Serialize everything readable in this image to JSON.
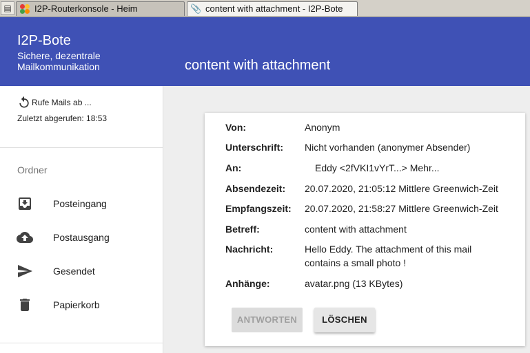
{
  "browser": {
    "menu_icon": "page-menu-icon",
    "tabs": [
      {
        "label": "I2P-Routerkonsole - Heim",
        "icon": "router-console-icon"
      },
      {
        "label": "content with attachment - I2P-Bote",
        "icon": "paperclip-icon"
      }
    ]
  },
  "header": {
    "app_title": "I2P-Bote",
    "subtitle": "Sichere, dezentrale Mailkommunikation",
    "page_title": "content with attachment",
    "color": "#3f51b5"
  },
  "sidebar": {
    "refresh_label": "Rufe Mails ab ...",
    "last_fetched": "Zuletzt abgerufen: 18:53",
    "folders_heading": "Ordner",
    "folders": [
      {
        "label": "Posteingang",
        "icon": "inbox-icon"
      },
      {
        "label": "Postausgang",
        "icon": "cloud-upload-icon"
      },
      {
        "label": "Gesendet",
        "icon": "send-icon"
      },
      {
        "label": "Papierkorb",
        "icon": "trash-icon"
      }
    ]
  },
  "message": {
    "from_label": "Von:",
    "from": "Anonym",
    "signature_label": "Unterschrift:",
    "signature": "Nicht vorhanden (anonymer Absender)",
    "to_label": "An:",
    "to": "Eddy <2fVKI1vYrT...> Mehr...",
    "sent_label": "Absendezeit:",
    "sent": "20.07.2020, 21:05:12 Mittlere Greenwich-Zeit",
    "received_label": "Empfangszeit:",
    "received": "20.07.2020, 21:58:27 Mittlere Greenwich-Zeit",
    "subject_label": "Betreff:",
    "subject": "content with attachment",
    "body_label": "Nachricht:",
    "body": "Hello Eddy. The attachment of this mail contains a small photo !",
    "attachments_label": "Anhänge:",
    "attachments": "avatar.png (13 KBytes)"
  },
  "actions": {
    "reply": "ANTWORTEN",
    "delete": "LÖSCHEN"
  }
}
